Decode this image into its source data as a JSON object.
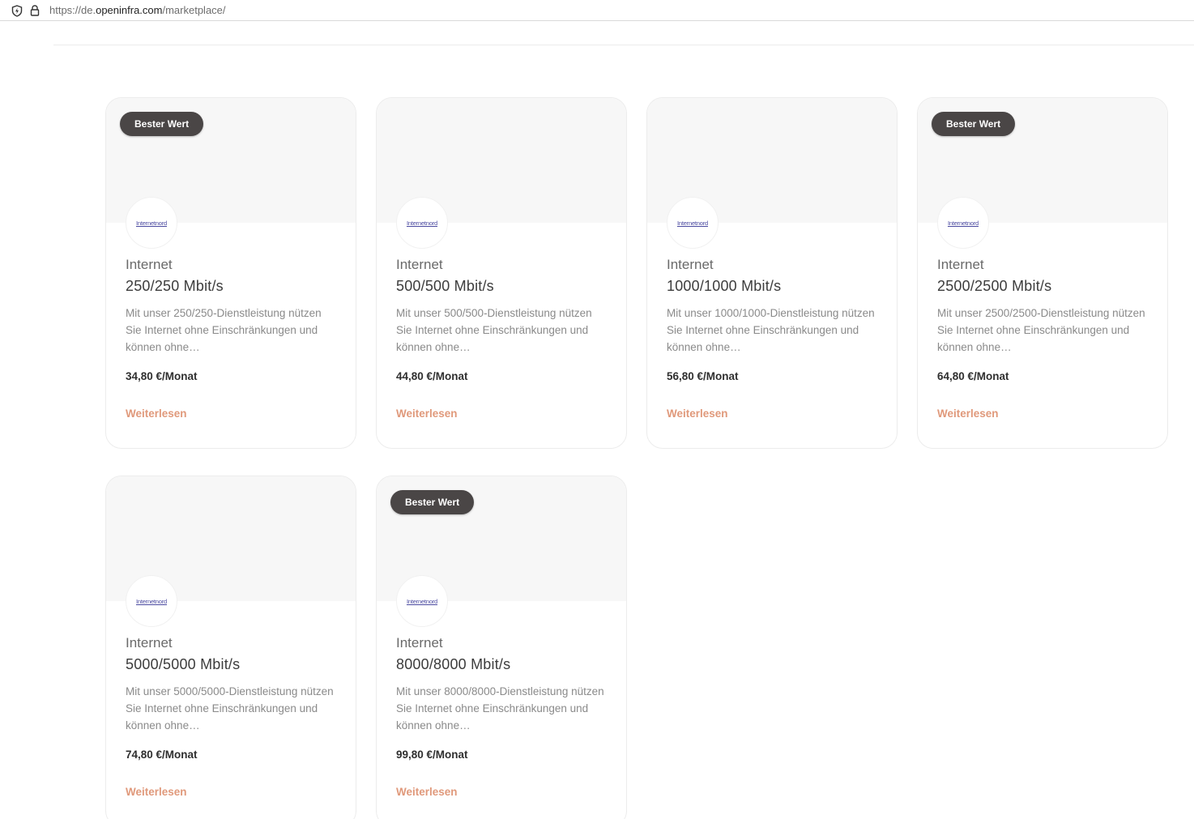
{
  "browser": {
    "url_prefix": "https://de.",
    "url_host": "openinfra.com",
    "url_path": "/marketplace/",
    "shield_icon": "shield-icon",
    "lock_icon": "lock-icon"
  },
  "colors": {
    "badge_bg": "#4a4646",
    "link": "#e0997b",
    "hero_bg": "#f7f7f7",
    "logo_text": "#4b4aa0"
  },
  "products": [
    {
      "badge": "Bester Wert",
      "logo": "Internetnord",
      "category": "Internet",
      "speed": "250/250 Mbit/s",
      "description": "Mit unser 250/250-Dienstleistung nützen Sie Internet ohne Einschränkungen und können ohne…",
      "price": "34,80 €/Monat",
      "link": "Weiterlesen"
    },
    {
      "badge": "",
      "logo": "Internetnord",
      "category": "Internet",
      "speed": "500/500 Mbit/s",
      "description": "Mit unser 500/500-Dienstleistung nützen Sie Internet ohne Einschränkungen und können ohne…",
      "price": "44,80 €/Monat",
      "link": "Weiterlesen"
    },
    {
      "badge": "",
      "logo": "Internetnord",
      "category": "Internet",
      "speed": "1000/1000 Mbit/s",
      "description": "Mit unser 1000/1000-Dienstleistung nützen Sie Internet ohne Einschränkungen und können ohne…",
      "price": "56,80 €/Monat",
      "link": "Weiterlesen"
    },
    {
      "badge": "Bester Wert",
      "logo": "Internetnord",
      "category": "Internet",
      "speed": "2500/2500 Mbit/s",
      "description": "Mit unser 2500/2500-Dienstleistung nützen Sie Internet ohne Einschränkungen und können ohne…",
      "price": "64,80 €/Monat",
      "link": "Weiterlesen"
    },
    {
      "badge": "",
      "logo": "Internetnord",
      "category": "Internet",
      "speed": "5000/5000 Mbit/s",
      "description": "Mit unser 5000/5000-Dienstleistung nützen Sie Internet ohne Einschränkungen und können ohne…",
      "price": "74,80 €/Monat",
      "link": "Weiterlesen"
    },
    {
      "badge": "Bester Wert",
      "logo": "Internetnord",
      "category": "Internet",
      "speed": "8000/8000 Mbit/s",
      "description": "Mit unser 8000/8000-Dienstleistung nützen Sie Internet ohne Einschränkungen und können ohne…",
      "price": "99,80 €/Monat",
      "link": "Weiterlesen"
    }
  ]
}
